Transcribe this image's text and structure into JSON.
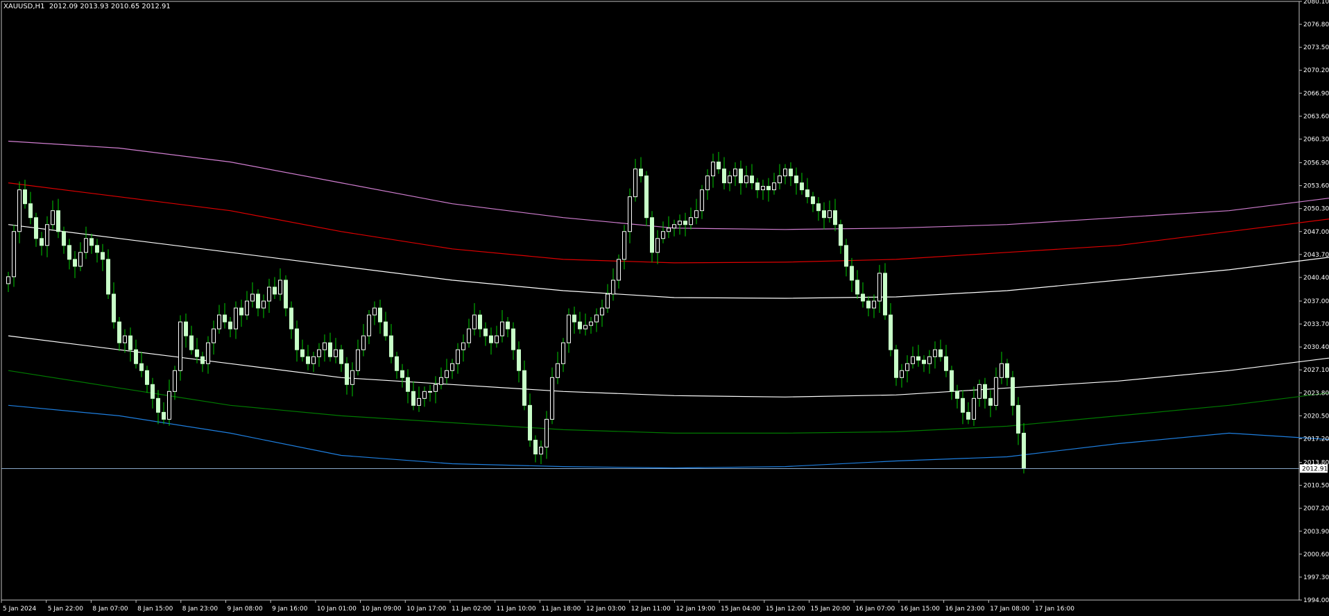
{
  "header": {
    "symbol": "XAUUSD,H1",
    "ohlc": "2012.09 2013.93 2010.65 2012.91"
  },
  "price_tag": "2012.91",
  "colors": {
    "background": "#000000",
    "frame": "#c0c0c0",
    "bull_candle": "#ffffff",
    "bear_candle": "#c8ffc8",
    "wick": "#00cc00",
    "price_line": "#8aa8c8",
    "envelope_red": "#e00000",
    "envelope_violet": "#d27fd2",
    "envelope_white": "#ffffff",
    "envelope_green": "#007a00",
    "envelope_blue": "#1e7fe0"
  },
  "chart_data": {
    "type": "candlestick",
    "title": "XAUUSD,H1",
    "ylim": [
      1994.0,
      2080.1
    ],
    "y_ticks": [
      "2080.10",
      "2076.80",
      "2073.50",
      "2070.20",
      "2066.90",
      "2063.60",
      "2060.30",
      "2056.90",
      "2053.60",
      "2050.30",
      "2047.00",
      "2043.70",
      "2040.40",
      "2037.00",
      "2033.70",
      "2030.40",
      "2027.10",
      "2023.80",
      "2020.50",
      "2017.20",
      "2013.80",
      "2010.50",
      "2007.20",
      "2003.90",
      "2000.60",
      "1997.30",
      "1994.00"
    ],
    "x_ticks": [
      "5 Jan 2024",
      "5 Jan 22:00",
      "8 Jan 07:00",
      "8 Jan 15:00",
      "8 Jan 23:00",
      "9 Jan 08:00",
      "9 Jan 16:00",
      "10 Jan 01:00",
      "10 Jan 09:00",
      "10 Jan 17:00",
      "11 Jan 02:00",
      "11 Jan 10:00",
      "11 Jan 18:00",
      "12 Jan 03:00",
      "12 Jan 11:00",
      "12 Jan 19:00",
      "15 Jan 04:00",
      "15 Jan 12:00",
      "15 Jan 20:00",
      "16 Jan 07:00",
      "16 Jan 15:00",
      "16 Jan 23:00",
      "17 Jan 08:00",
      "17 Jan 16:00"
    ],
    "last_price": 2012.91,
    "grid": false,
    "close": [
      2040.5,
      2047,
      2053,
      2051,
      2049,
      2046,
      2045,
      2048,
      2050,
      2047,
      2045,
      2043,
      2042,
      2044,
      2046,
      2045,
      2044,
      2043,
      2038,
      2034,
      2031,
      2032,
      2030,
      2028,
      2027,
      2025,
      2023,
      2021,
      2020,
      2024,
      2027,
      2034,
      2032,
      2030,
      2029,
      2028,
      2031,
      2033,
      2035,
      2034,
      2033,
      2036,
      2035,
      2037,
      2038,
      2036,
      2037,
      2039,
      2038,
      2040,
      2036,
      2033,
      2030,
      2029,
      2028,
      2029,
      2030,
      2031,
      2029,
      2030,
      2028,
      2025,
      2027,
      2030,
      2032,
      2035,
      2036,
      2034,
      2032,
      2029,
      2027,
      2026,
      2024,
      2022,
      2023,
      2024,
      2024,
      2025,
      2026,
      2027,
      2028,
      2030,
      2031,
      2033,
      2035,
      2033,
      2032,
      2031,
      2032,
      2034,
      2033,
      2030,
      2027,
      2022,
      2017,
      2015,
      2016,
      2020,
      2026,
      2028,
      2031,
      2035,
      2034,
      2033,
      2033.5,
      2034,
      2035,
      2036,
      2038,
      2040,
      2043,
      2047,
      2052,
      2056,
      2055,
      2049,
      2044,
      2046,
      2047,
      2047.5,
      2048,
      2048.5,
      2048,
      2049,
      2050,
      2053,
      2055,
      2057,
      2056,
      2054,
      2055,
      2056,
      2054,
      2055,
      2054,
      2053,
      2053.5,
      2053,
      2054,
      2055,
      2056,
      2055,
      2054,
      2053,
      2052,
      2051,
      2050,
      2049,
      2050,
      2048,
      2045,
      2042,
      2040,
      2038,
      2037,
      2036,
      2037,
      2041,
      2035,
      2030,
      2026,
      2027,
      2028,
      2029,
      2028.5,
      2028,
      2029,
      2030,
      2029,
      2027,
      2024,
      2023,
      2021,
      2020,
      2023,
      2025,
      2023,
      2022,
      2026,
      2028,
      2026,
      2022,
      2018,
      2012.91
    ],
    "series": [
      {
        "name": "",
        "color": "#d27fd2",
        "points": [
          [
            0,
            2060
          ],
          [
            20,
            2059
          ],
          [
            40,
            2057
          ],
          [
            60,
            2054
          ],
          [
            80,
            2051
          ],
          [
            100,
            2049
          ],
          [
            120,
            2047.5
          ],
          [
            140,
            2047.3
          ],
          [
            160,
            2047.5
          ],
          [
            180,
            2048
          ],
          [
            200,
            2049
          ],
          [
            220,
            2050
          ],
          [
            240,
            2052
          ],
          [
            260,
            2055
          ],
          [
            280,
            2060
          ],
          [
            300,
            2064
          ],
          [
            320,
            2065.7
          ],
          [
            340,
            2065
          ],
          [
            360,
            2063
          ],
          [
            380,
            2060
          ],
          [
            400,
            2057
          ],
          [
            420,
            2054
          ],
          [
            440,
            2052.5
          ]
        ]
      },
      {
        "name": "",
        "color": "#e00000",
        "points": [
          [
            0,
            2054
          ],
          [
            20,
            2052
          ],
          [
            40,
            2050
          ],
          [
            60,
            2047
          ],
          [
            80,
            2044.5
          ],
          [
            100,
            2043
          ],
          [
            120,
            2042.5
          ],
          [
            140,
            2042.6
          ],
          [
            160,
            2043
          ],
          [
            180,
            2044
          ],
          [
            200,
            2045
          ],
          [
            220,
            2047
          ],
          [
            240,
            2049
          ],
          [
            260,
            2052
          ],
          [
            280,
            2056
          ],
          [
            300,
            2058.5
          ],
          [
            320,
            2059.6
          ],
          [
            340,
            2059.3
          ],
          [
            360,
            2058
          ],
          [
            380,
            2055.5
          ],
          [
            400,
            2052.5
          ],
          [
            420,
            2049.5
          ],
          [
            440,
            2046.5
          ]
        ]
      },
      {
        "name": "",
        "color": "#ffffff",
        "points": [
          [
            0,
            2048
          ],
          [
            20,
            2046
          ],
          [
            40,
            2044
          ],
          [
            60,
            2042
          ],
          [
            80,
            2040
          ],
          [
            100,
            2038.5
          ],
          [
            120,
            2037.5
          ],
          [
            140,
            2037.4
          ],
          [
            160,
            2037.6
          ],
          [
            180,
            2038.5
          ],
          [
            200,
            2040
          ],
          [
            220,
            2041.5
          ],
          [
            240,
            2043.5
          ],
          [
            260,
            2046
          ],
          [
            280,
            2049
          ],
          [
            300,
            2051.5
          ],
          [
            320,
            2052.7
          ],
          [
            340,
            2052.4
          ],
          [
            360,
            2051
          ],
          [
            380,
            2049
          ],
          [
            400,
            2046.5
          ],
          [
            420,
            2043.5
          ],
          [
            440,
            2041
          ]
        ]
      },
      {
        "name": "",
        "color": "#ffffff",
        "points": [
          [
            0,
            2032
          ],
          [
            20,
            2030
          ],
          [
            40,
            2028
          ],
          [
            60,
            2026
          ],
          [
            80,
            2025
          ],
          [
            100,
            2024
          ],
          [
            120,
            2023.4
          ],
          [
            140,
            2023.2
          ],
          [
            160,
            2023.5
          ],
          [
            180,
            2024.5
          ],
          [
            200,
            2025.5
          ],
          [
            220,
            2027
          ],
          [
            240,
            2029
          ],
          [
            260,
            2031
          ],
          [
            280,
            2033.5
          ],
          [
            300,
            2035.2
          ],
          [
            320,
            2036
          ],
          [
            340,
            2035.6
          ],
          [
            360,
            2034.8
          ],
          [
            380,
            2033.2
          ],
          [
            400,
            2031
          ]
        ]
      },
      {
        "name": "",
        "color": "#007a00",
        "points": [
          [
            0,
            2027
          ],
          [
            20,
            2024.5
          ],
          [
            40,
            2022
          ],
          [
            60,
            2020.5
          ],
          [
            80,
            2019.5
          ],
          [
            100,
            2018.5
          ],
          [
            120,
            2018
          ],
          [
            140,
            2018
          ],
          [
            160,
            2018.2
          ],
          [
            180,
            2019
          ],
          [
            200,
            2020.5
          ],
          [
            220,
            2022
          ],
          [
            240,
            2024
          ],
          [
            260,
            2026.5
          ],
          [
            280,
            2028.8
          ],
          [
            300,
            2030
          ],
          [
            320,
            2030.4
          ],
          [
            340,
            2030.1
          ],
          [
            360,
            2029
          ],
          [
            380,
            2027.5
          ],
          [
            400,
            2025
          ]
        ]
      },
      {
        "name": "",
        "color": "#1e7fe0",
        "points": [
          [
            0,
            2022
          ],
          [
            20,
            2020.5
          ],
          [
            40,
            2018
          ],
          [
            60,
            2014.8
          ],
          [
            80,
            2013.6
          ],
          [
            100,
            2013.2
          ],
          [
            120,
            2013
          ],
          [
            140,
            2013.2
          ],
          [
            160,
            2014
          ],
          [
            180,
            2014.6
          ],
          [
            200,
            2016.5
          ],
          [
            220,
            2018
          ],
          [
            240,
            2017
          ],
          [
            260,
            2019.2
          ],
          [
            280,
            2022
          ],
          [
            300,
            2024.2
          ],
          [
            320,
            2025.1
          ],
          [
            340,
            2025.2
          ],
          [
            360,
            2024.9
          ],
          [
            380,
            2023.2
          ],
          [
            400,
            2020.5
          ],
          [
            420,
            2016
          ],
          [
            440,
            2008.3
          ]
        ]
      }
    ]
  }
}
